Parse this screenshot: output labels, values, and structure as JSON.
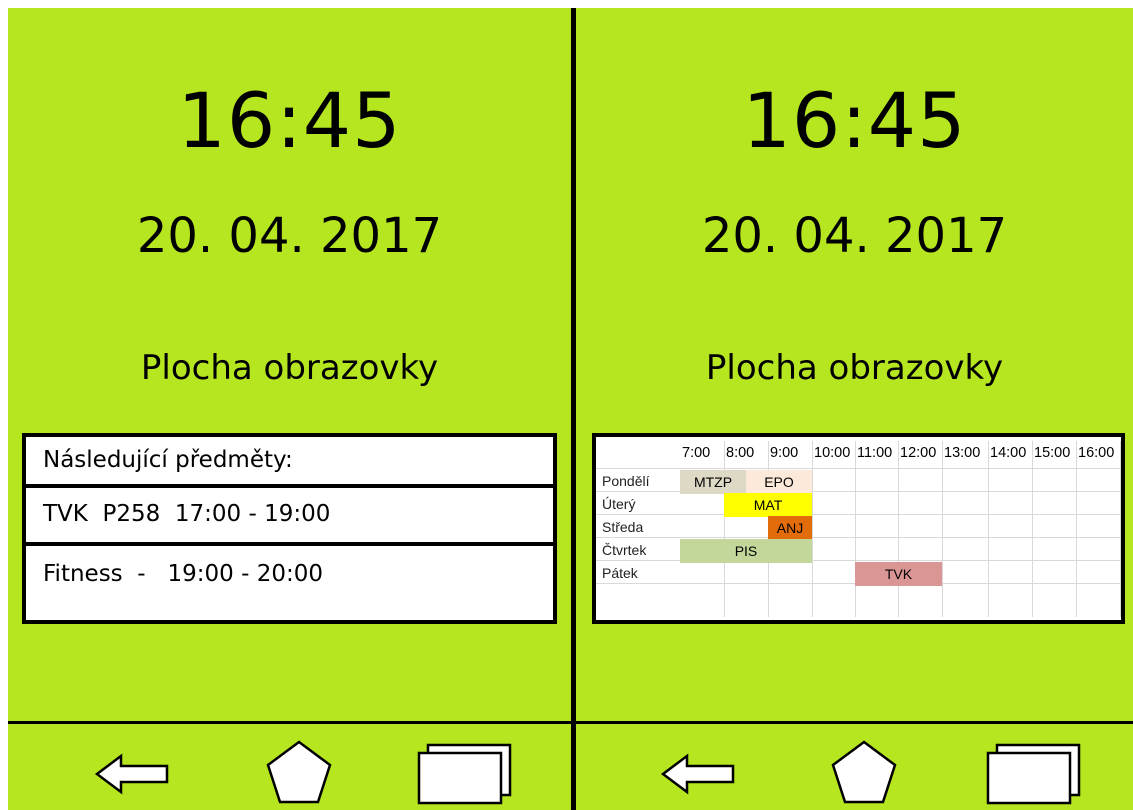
{
  "left": {
    "clock": "16:45",
    "date": "20. 04. 2017",
    "title": "Plocha obrazovky",
    "next_subjects": {
      "header": "Následující předměty:",
      "items": [
        "TVK  P258  17:00 - 19:00",
        "Fitness  -   19:00 - 20:00"
      ]
    }
  },
  "right": {
    "clock": "16:45",
    "date": "20. 04. 2017",
    "title": "Plocha obrazovky",
    "timetable": {
      "hours": [
        "7:00",
        "8:00",
        "9:00",
        "10:00",
        "11:00",
        "12:00",
        "13:00",
        "14:00",
        "15:00",
        "16:00"
      ],
      "days": [
        "Pondělí",
        "Úterý",
        "Středa",
        "Čtvrtek",
        "Pátek"
      ],
      "blocks": [
        {
          "day": 0,
          "start": "7:00",
          "end": "8:30",
          "label": "MTZP",
          "color": "#ddd9c4"
        },
        {
          "day": 0,
          "start": "8:30",
          "end": "10:00",
          "label": "EPO",
          "color": "#fde9d9"
        },
        {
          "day": 1,
          "start": "8:00",
          "end": "10:00",
          "label": "MAT",
          "color": "#ffff00"
        },
        {
          "day": 2,
          "start": "9:00",
          "end": "10:00",
          "label": "ANJ",
          "color": "#e26b0a"
        },
        {
          "day": 3,
          "start": "7:00",
          "end": "10:00",
          "label": "PIS",
          "color": "#c4d79b"
        },
        {
          "day": 4,
          "start": "11:00",
          "end": "13:00",
          "label": "TVK",
          "color": "#da9694"
        }
      ]
    }
  },
  "nav": {
    "back_icon": "back-arrow-icon",
    "home_icon": "home-pentagon-icon",
    "recents_icon": "recent-apps-icon"
  },
  "colors": {
    "screen_bg": "#b6e61f",
    "border": "#000000"
  }
}
